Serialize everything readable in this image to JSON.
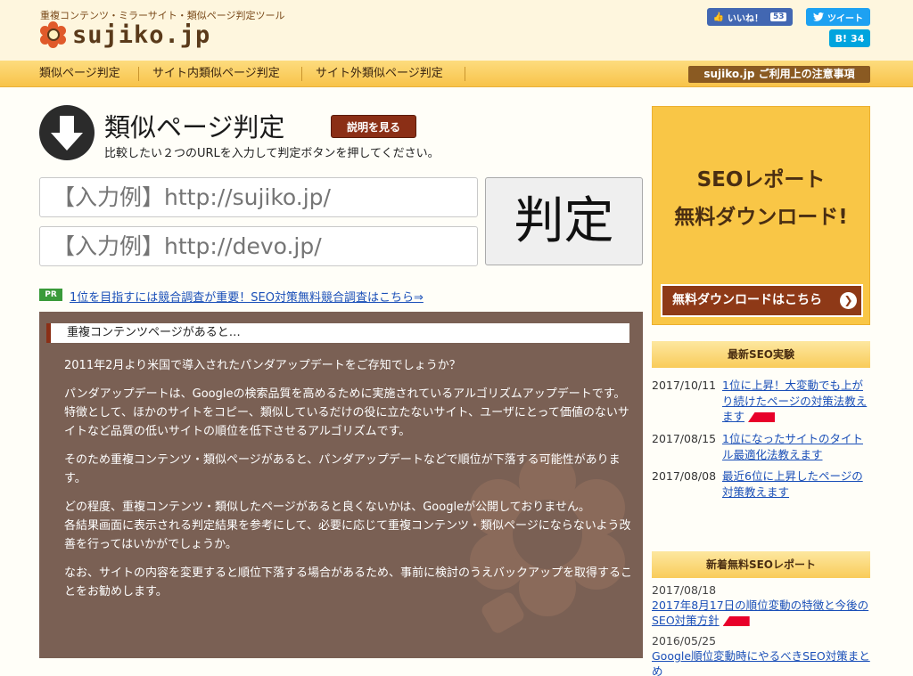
{
  "header": {
    "tagline": "重複コンテンツ・ミラーサイト・類似ページ判定ツール",
    "logo_text": "sujiko.jp",
    "social": {
      "facebook_label": "いいね！",
      "facebook_count": "53",
      "twitter_label": "ツイート",
      "hatena_label": "B!",
      "hatena_count": "34"
    }
  },
  "nav": {
    "items": [
      "類似ページ判定",
      "サイト内類似ページ判定",
      "サイト外類似ページ判定"
    ],
    "notice": "sujiko.jp ご利用上の注意事項"
  },
  "main": {
    "title": "類似ページ判定",
    "explain_button": "説明を見る",
    "instruction": "比較したい２つのURLを入力して判定ボタンを押してください。",
    "url1_placeholder": "【入力例】http://sujiko.jp/",
    "url2_placeholder": "【入力例】http://devo.jp/",
    "judge_button": "判定",
    "pr_badge": "PR",
    "pr_link": "1位を目指すには競合調査が重要！SEO対策無料競合調査はこちら⇒"
  },
  "article": {
    "heading": "重複コンテンツページがあると…",
    "paragraphs": [
      [
        "2011年2月より米国で導入されたパンダアップデートをご存知でしょうか？"
      ],
      [
        "パンダアップデートは、Googleの検索品質を高めるために実施されているアルゴリズムアップデートです。",
        "特徴として、ほかのサイトをコピー、類似しているだけの役に立たないサイト、ユーザにとって価値のないサイトなど品質の低いサイトの順位を低下させるアルゴリズムです。"
      ],
      [
        "そのため重複コンテンツ・類似ページがあると、パンダアップデートなどで順位が下落する可能性があります。"
      ],
      [
        "どの程度、重複コンテンツ・類似したページがあると良くないかは、Googleが公開しておりません。",
        "各結果画面に表示される判定結果を参考にして、必要に応じて重複コンテンツ・類似ページにならないよう改善を行ってはいかがでしょうか。"
      ],
      [
        "なお、サイトの内容を変更すると順位下落する場合があるため、事前に検討のうえバックアップを取得することをお勧めします。"
      ]
    ]
  },
  "sidebar": {
    "seo_report": {
      "line1": "SEOレポート",
      "line2": "無料ダウンロード!",
      "button": "無料ダウンロードはこちら"
    },
    "experiments_title": "最新SEO実験",
    "experiments": [
      {
        "date": "2017/10/11",
        "title": "1位に上昇！大変動でも上がり続けたページの対策法教えます",
        "new": true
      },
      {
        "date": "2017/08/15",
        "title": "1位になったサイトのタイトル最適化法教えます",
        "new": false
      },
      {
        "date": "2017/08/08",
        "title": "最近6位に上昇したページの対策教えます",
        "new": false
      }
    ],
    "reports_title": "新着無料SEOレポート",
    "reports": [
      {
        "date": "2017/08/18",
        "title": "2017年8月17日の順位変動の特徴と今後のSEO対策方針",
        "new": true
      },
      {
        "date": "2016/05/25",
        "title": "Google順位変動時にやるべきSEO対策まとめ",
        "new": false
      }
    ]
  }
}
